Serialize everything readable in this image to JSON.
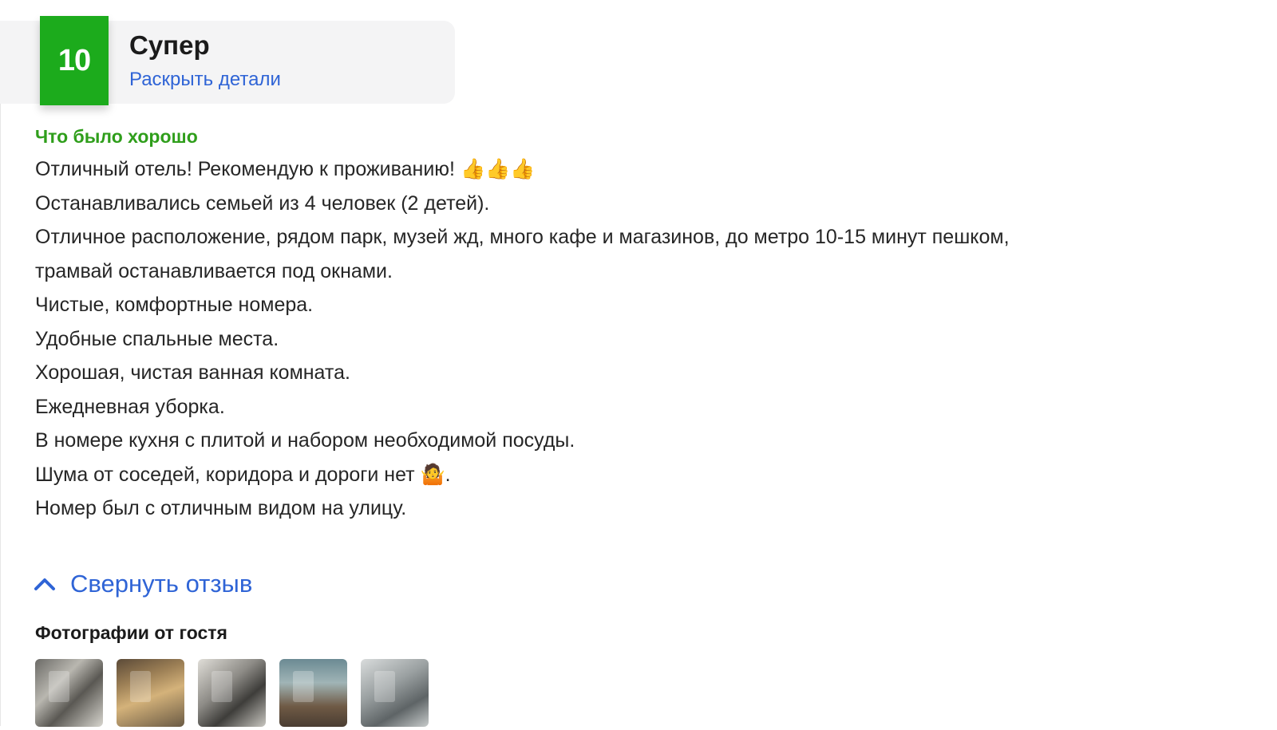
{
  "rating": {
    "score": "10",
    "label": "Супер",
    "details_link": "Раскрыть детали",
    "badge_color": "#1cab1c"
  },
  "review": {
    "section_heading": "Что было хорошо",
    "lines": [
      "Отличный отель! Рекомендую к проживанию! 👍👍👍",
      "Останавливались семьей из 4 человек (2 детей).",
      "Отличное расположение, рядом парк, музей жд, много кафе и магазинов, до метро 10-15 минут пешком,",
      "трамвай останавливается под окнами.",
      "Чистые, комфортные номера.",
      "Удобные спальные места.",
      "Хорошая, чистая ванная комната.",
      "Ежедневная уборка.",
      "В номере кухня с плитой и набором необходимой посуды.",
      "Шума от соседей, коридора и дороги нет 🤷.",
      "Номер был с отличным видом на улицу."
    ]
  },
  "collapse": {
    "label": "Свернуть отзыв",
    "icon": "chevron-up-icon"
  },
  "photos": {
    "heading": "Фотографии от гостя",
    "items": [
      {
        "alt": "guest-photo-1"
      },
      {
        "alt": "guest-photo-2"
      },
      {
        "alt": "guest-photo-3"
      },
      {
        "alt": "guest-photo-4"
      },
      {
        "alt": "guest-photo-5"
      }
    ]
  },
  "colors": {
    "accent_link": "#2f64d6",
    "positive_heading": "#2f9e1b"
  }
}
